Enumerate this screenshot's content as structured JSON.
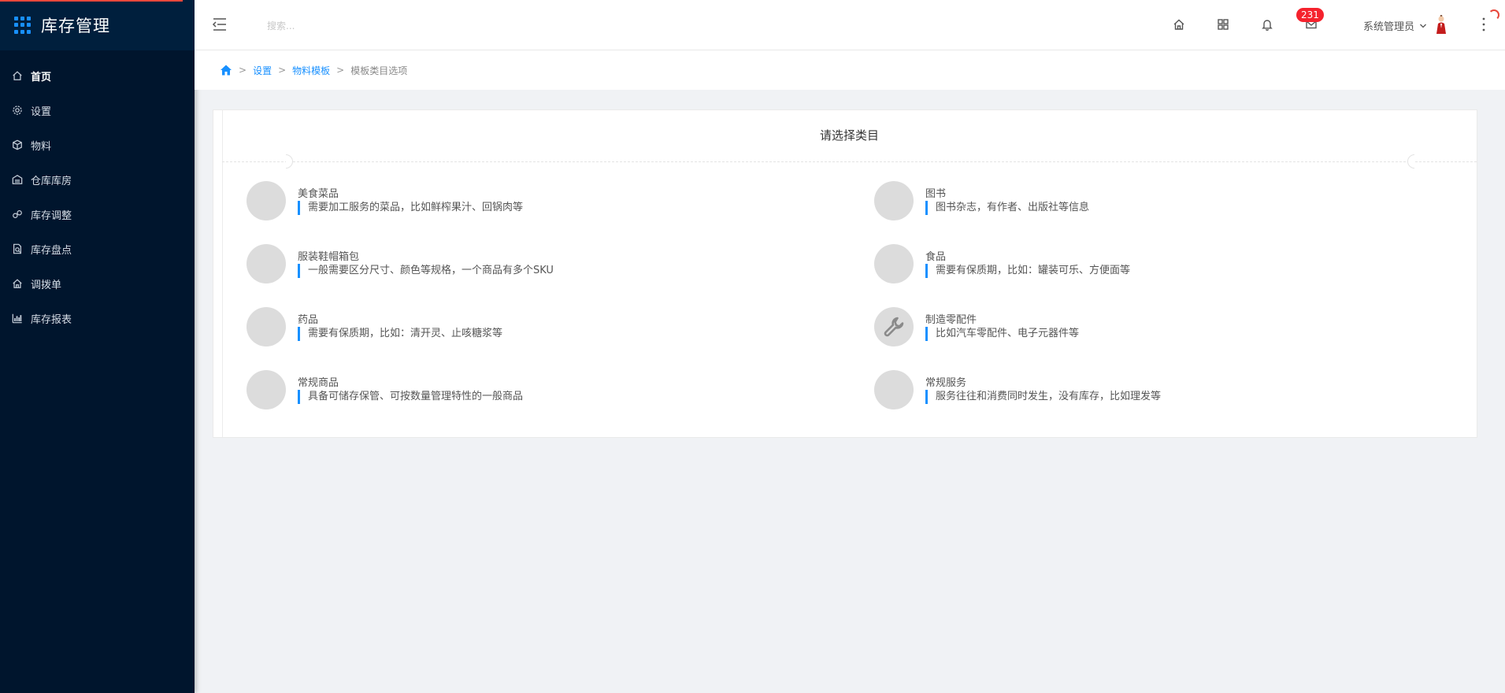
{
  "app": {
    "title": "库存管理"
  },
  "sidebar": {
    "items": [
      {
        "label": "首页",
        "icon": "home-icon",
        "active": true
      },
      {
        "label": "设置",
        "icon": "gear-icon"
      },
      {
        "label": "物料",
        "icon": "box-icon"
      },
      {
        "label": "仓库库房",
        "icon": "warehouse-icon"
      },
      {
        "label": "库存调整",
        "icon": "adjust-icon"
      },
      {
        "label": "库存盘点",
        "icon": "inventory-check-icon"
      },
      {
        "label": "调拨单",
        "icon": "transfer-icon"
      },
      {
        "label": "库存报表",
        "icon": "bar-chart-icon"
      }
    ]
  },
  "header": {
    "search_placeholder": "搜索...",
    "message_count": "231",
    "user_name": "系统管理员"
  },
  "breadcrumb": {
    "items": [
      "设置",
      "物料模板"
    ],
    "current": "模板类目选项",
    "separator": ">"
  },
  "main": {
    "title": "请选择类目",
    "categories": [
      {
        "name": "美食菜品",
        "desc": "需要加工服务的菜品，比如鲜榨果汁、回锅肉等"
      },
      {
        "name": "图书",
        "desc": "图书杂志，有作者、出版社等信息"
      },
      {
        "name": "服装鞋帽箱包",
        "desc": "一般需要区分尺寸、颜色等规格，一个商品有多个SKU"
      },
      {
        "name": "食品",
        "desc": "需要有保质期，比如：罐装可乐、方便面等"
      },
      {
        "name": "药品",
        "desc": "需要有保质期，比如：清开灵、止咳糖浆等"
      },
      {
        "name": "制造零配件",
        "desc": "比如汽车零配件、电子元器件等",
        "icon": "wrench-icon"
      },
      {
        "name": "常规商品",
        "desc": "具备可储存保管、可按数量管理特性的一般商品"
      },
      {
        "name": "常规服务",
        "desc": "服务往往和消费同时发生，没有库存，比如理发等"
      }
    ]
  },
  "colors": {
    "sidebar_bg": "#00152d",
    "accent": "#1890ff",
    "badge": "#f5222d"
  }
}
